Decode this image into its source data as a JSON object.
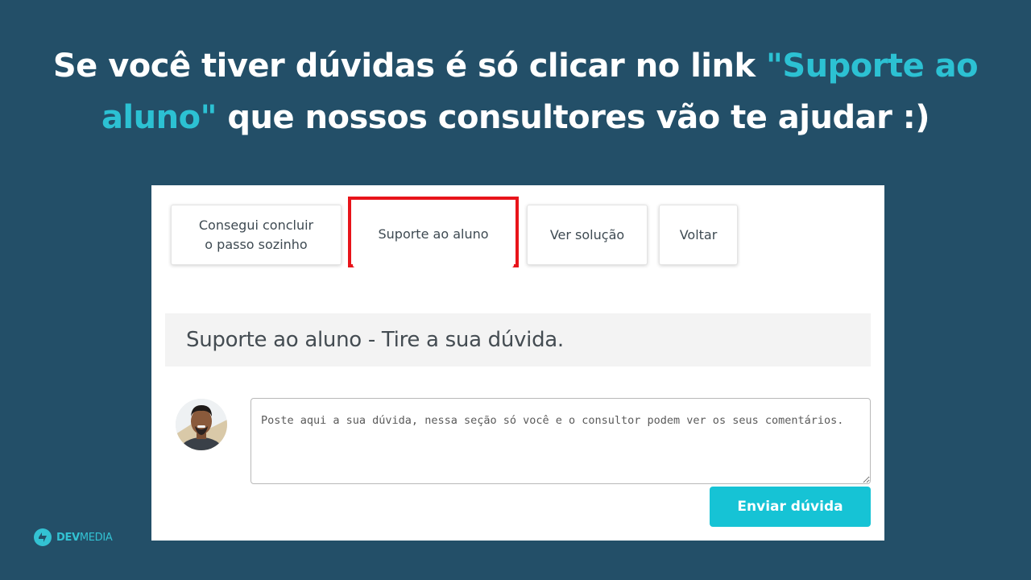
{
  "headline": {
    "part1": "Se você tiver dúvidas é só clicar no link ",
    "highlight": "\"Suporte ao aluno\"",
    "part2": " que nossos consultores vão te ajudar :)"
  },
  "step_buttons": {
    "concluir_line1": "Consegui concluir",
    "concluir_line2": "o passo sozinho",
    "suporte": "Suporte ao aluno",
    "solucao": "Ver solução",
    "voltar": "Voltar"
  },
  "section": {
    "title": "Suporte ao aluno - Tire a sua dúvida."
  },
  "question_form": {
    "placeholder": "Poste aqui a sua dúvida, nessa seção só você e o consultor podem ver os seus comentários.",
    "value": "",
    "submit_label": "Enviar dúvida"
  },
  "branding": {
    "logo_bold": "DEV",
    "logo_light": "MEDIA"
  },
  "colors": {
    "background": "#234f68",
    "accent": "#2cc1d3",
    "highlight_border": "#e8141a",
    "submit_button": "#16c3d5"
  }
}
